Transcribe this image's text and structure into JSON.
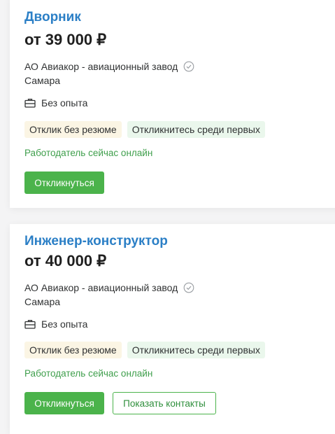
{
  "vacancies": [
    {
      "title": "Дворник",
      "salary": "от 39 000 ₽",
      "company": "АО Авиакор - авиационный завод",
      "city": "Самара",
      "experience": "Без опыта",
      "tags": [
        "Отклик без резюме",
        "Откликнитесь среди первых"
      ],
      "online_status": "Работодатель сейчас онлайн",
      "respond_label": "Откликнуться"
    },
    {
      "title": "Инженер-конструктор",
      "salary": "от 40 000 ₽",
      "company": "АО Авиакор - авиационный завод",
      "city": "Самара",
      "experience": "Без опыта",
      "tags": [
        "Отклик без резюме",
        "Откликнитесь среди первых"
      ],
      "online_status": "Работодатель сейчас онлайн",
      "respond_label": "Откликнуться",
      "contacts_label": "Показать контакты"
    }
  ],
  "icons": {
    "verified": "check-circle-icon",
    "experience": "briefcase-icon"
  },
  "colors": {
    "title_link": "#2b7fc6",
    "primary_button": "#4bb34b",
    "online_text": "#3f9f4c",
    "tag_yellow": "#fbf5e4",
    "tag_green": "#eaf7ec"
  }
}
